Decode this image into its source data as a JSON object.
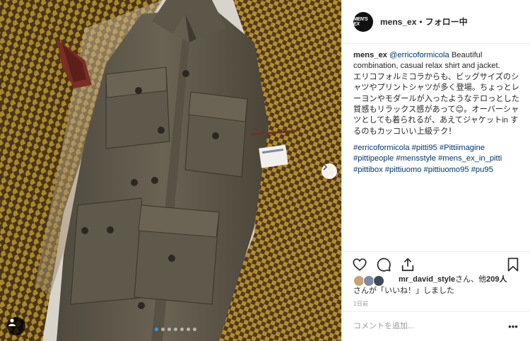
{
  "post": {
    "account": {
      "avatar_text": "MEN'S EX",
      "username": "mens_ex",
      "separator": "•",
      "follow_label": "フォロー中"
    },
    "caption": {
      "username": "mens_ex",
      "mention": "@erricoformicola",
      "english": "Beautiful combination, casual relax shirt and jacket.",
      "japanese": "エリコフォルミコラからも、ビッグサイズのシャツやプリントシャツが多く登場。ちょっとレーヨンやモダールが入ったようなテロっとした質感もリラックス感があって😊。オーバーシャツとしても着られるが、あえてジャケットin するのもカッコいい上級テク！"
    },
    "hashtags": [
      "#erricoformicola",
      "#pitti95",
      "#Pittiimagine",
      "#pittipeople",
      "#mensstyle",
      "#mens_ex_in_pitti",
      "#pittibox",
      "#pittiuomo",
      "#pittiuomo95",
      "#pu95"
    ],
    "actions": {
      "like_icon": "heart-icon",
      "comment_icon": "comment-icon",
      "share_icon": "share-icon",
      "save_icon": "bookmark-icon"
    },
    "likes": {
      "liker": "mr_david_style",
      "suffix": "さん、他",
      "count": "209人",
      "line2": "さんが「いいね！」しました"
    },
    "date": "1日前",
    "comment": {
      "placeholder": "コメントを追加...",
      "more_label": "•••"
    },
    "carousel": {
      "total_slides": 7,
      "active_index": 0
    },
    "colors": {
      "link": "#003569",
      "accent": "#3897f0",
      "border": "#efefef"
    }
  }
}
